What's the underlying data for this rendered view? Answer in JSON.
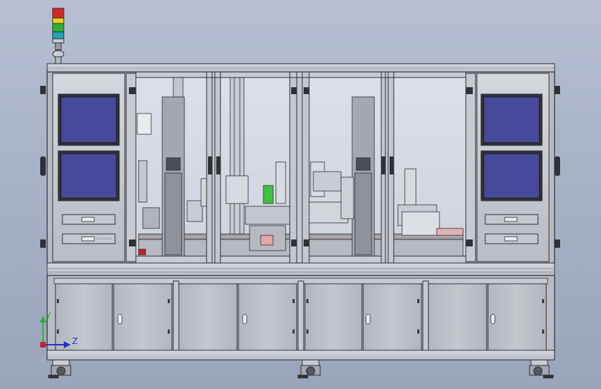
{
  "colors": {
    "background_top": "#b6bfd2",
    "background_bottom": "#9aa4ba",
    "frame": "#c9ccd2",
    "frame_dark": "#8a8d94",
    "outline": "#2a2c30",
    "panel": "#bdc0c6",
    "screen": "#47499a",
    "glass": "#d8dbe6",
    "signal_red": "#d9262b",
    "signal_yellow": "#e9d217",
    "signal_green": "#2fae3a",
    "signal_cyan": "#1fa5b5",
    "axis_z": "#2530d8",
    "axis_y": "#2fae3a",
    "machine_part": "#a4a7ae",
    "part_green": "#3fc23d",
    "part_red": "#c9202a"
  },
  "icons": {
    "signal_tower": "signal-tower-icon",
    "axis_triad": "axis-triad-icon",
    "caster_wheel": "caster-wheel-icon",
    "door_handle": "door-handle-icon",
    "lock": "keyhole-icon"
  },
  "axes": {
    "z_label": "Z",
    "y_label": "Y"
  },
  "layout": {
    "left_screens": 2,
    "right_screens": 2,
    "glass_doors": 4,
    "lower_cabinet_doors": 8,
    "casters": 3
  }
}
